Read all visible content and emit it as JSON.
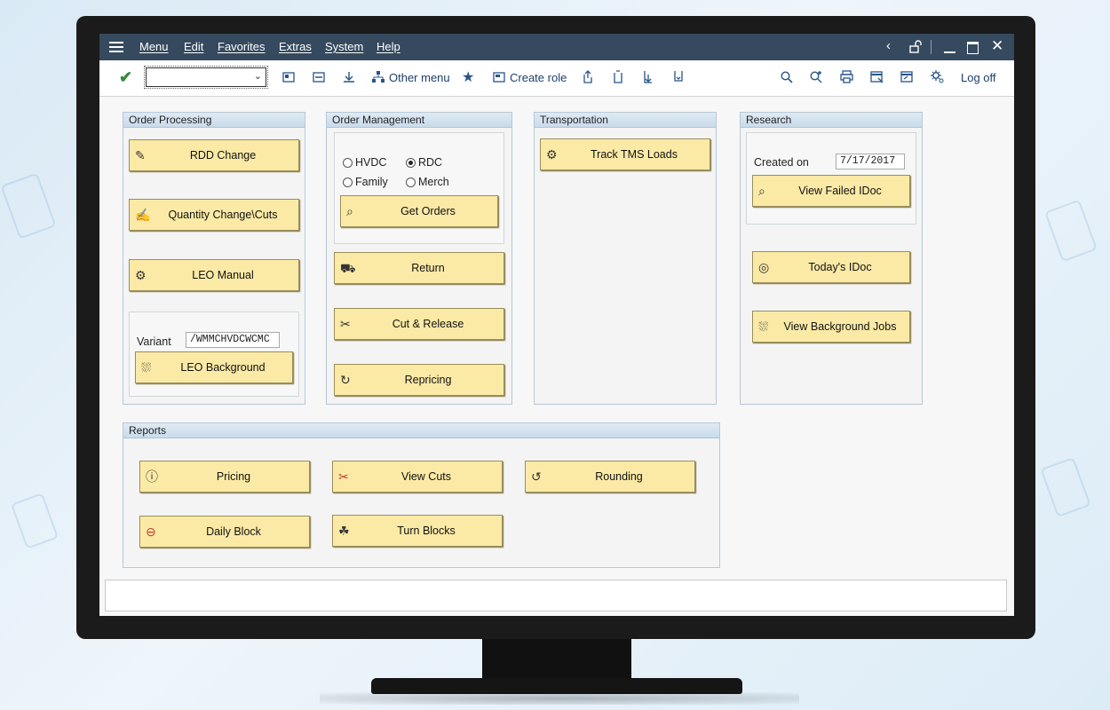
{
  "menubar": {
    "items": [
      "Menu",
      "Edit",
      "Favorites",
      "Extras",
      "System",
      "Help"
    ]
  },
  "toolbar": {
    "command_value": "",
    "other_menu": "Other menu",
    "create_role": "Create role",
    "log_off": "Log off"
  },
  "order_processing": {
    "title": "Order Processing",
    "rdd_change": "RDD Change",
    "quantity_change": "Quantity Change\\Cuts",
    "leo_manual": "LEO Manual",
    "variant_label": "Variant",
    "variant_value": "/WMMCHVDCWCMC",
    "leo_background": "LEO Background"
  },
  "order_management": {
    "title": "Order Management",
    "radio_hvdc": "HVDC",
    "radio_rdc": "RDC",
    "radio_family": "Family",
    "radio_merch": "Merch",
    "selected": "RDC",
    "get_orders": "Get Orders",
    "return": "Return",
    "cut_release": "Cut & Release",
    "repricing": "Repricing"
  },
  "transportation": {
    "title": "Transportation",
    "track_tms": "Track TMS Loads"
  },
  "research": {
    "title": "Research",
    "created_on_label": "Created on",
    "created_on_value": "7/17/2017",
    "view_failed_idoc": "View Failed IDoc",
    "todays_idoc": "Today's IDoc",
    "view_background_jobs": "View Background Jobs"
  },
  "reports": {
    "title": "Reports",
    "pricing": "Pricing",
    "view_cuts": "View Cuts",
    "rounding": "Rounding",
    "daily_block": "Daily Block",
    "turn_blocks": "Turn Blocks"
  }
}
